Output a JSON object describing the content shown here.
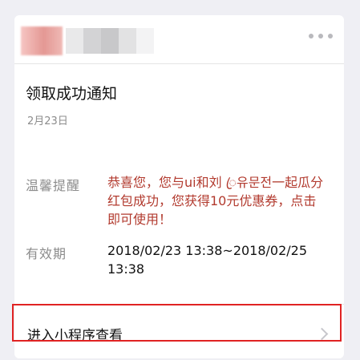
{
  "header": {
    "more_icon": "more-dots-icon"
  },
  "card": {
    "title": "领取成功通知",
    "date": "2月23日"
  },
  "fields": [
    {
      "label": "温馨提醒",
      "value": "恭喜您，您与ui和刘 ꦿ유문전一起瓜分红包成功，您获得10元优惠券，点击即可使用！"
    },
    {
      "label": "有效期",
      "value": "2018/02/23 13:38~2018/02/25 13:38"
    }
  ],
  "entry": {
    "label": "进入小程序查看",
    "chevron_icon": "chevron-right-icon"
  },
  "colors": {
    "tip_text": "#b23a2e",
    "highlight_border": "#e02222",
    "secondary_text": "#8c8c8c"
  }
}
